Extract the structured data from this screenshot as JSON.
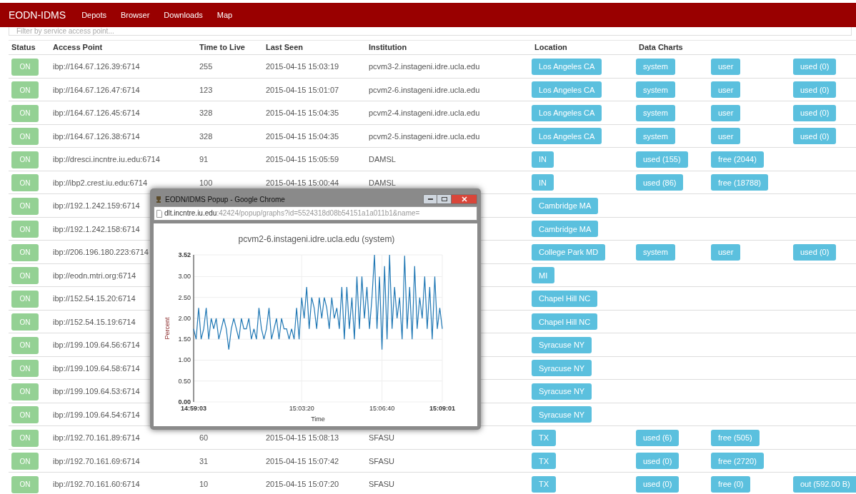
{
  "navbar": {
    "brand": "EODN-IDMS",
    "links": [
      "Depots",
      "Browser",
      "Downloads",
      "Map"
    ]
  },
  "filter": {
    "placeholder": "Filter by service access point..."
  },
  "table": {
    "columns": [
      "Status",
      "Access Point",
      "Time to Live",
      "Last Seen",
      "Institution",
      "Location",
      "Data Charts"
    ],
    "rows": [
      {
        "status": "ON",
        "access_point": "ibp://164.67.126.39:6714",
        "ttl": "255",
        "last_seen": "2015-04-15 15:03:19",
        "institution": "pcvm3-2.instageni.idre.ucla.edu",
        "location": "Los Angeles CA",
        "charts": [
          "system",
          "user",
          "used (0)"
        ]
      },
      {
        "status": "ON",
        "access_point": "ibp://164.67.126.47:6714",
        "ttl": "123",
        "last_seen": "2015-04-15 15:01:07",
        "institution": "pcvm2-6.instageni.idre.ucla.edu",
        "location": "Los Angeles CA",
        "charts": [
          "system",
          "user",
          "used (0)"
        ]
      },
      {
        "status": "ON",
        "access_point": "ibp://164.67.126.45:6714",
        "ttl": "328",
        "last_seen": "2015-04-15 15:04:35",
        "institution": "pcvm2-4.instageni.idre.ucla.edu",
        "location": "Los Angeles CA",
        "charts": [
          "system",
          "user",
          "used (0)"
        ]
      },
      {
        "status": "ON",
        "access_point": "ibp://164.67.126.38:6714",
        "ttl": "328",
        "last_seen": "2015-04-15 15:04:35",
        "institution": "pcvm2-5.instageni.idre.ucla.edu",
        "location": "Los Angeles CA",
        "charts": [
          "system",
          "user",
          "used (0)"
        ]
      },
      {
        "status": "ON",
        "access_point": "ibp://dresci.incntre.iu.edu:6714",
        "ttl": "91",
        "last_seen": "2015-04-15 15:05:59",
        "institution": "DAMSL",
        "location": "IN",
        "charts": [
          "used (155)",
          "free (2044)"
        ]
      },
      {
        "status": "ON",
        "access_point": "ibp://ibp2.crest.iu.edu:6714",
        "ttl": "100",
        "last_seen": "2015-04-15 15:00:44",
        "institution": "DAMSL",
        "location": "IN",
        "charts": [
          "used (86)",
          "free (18788)"
        ]
      },
      {
        "status": "ON",
        "access_point": "ibp://192.1.242.159:6714",
        "location": "Cambridge MA"
      },
      {
        "status": "ON",
        "access_point": "ibp://192.1.242.158:6714",
        "location": "Cambridge MA"
      },
      {
        "status": "ON",
        "access_point": "ibp://206.196.180.223:6714",
        "location": "College Park MD",
        "charts": [
          "system",
          "user",
          "used (0)"
        ]
      },
      {
        "status": "ON",
        "access_point": "ibp://eodn.mtri.org:6714",
        "location": "MI"
      },
      {
        "status": "ON",
        "access_point": "ibp://152.54.15.20:6714",
        "location": "Chapel Hill NC"
      },
      {
        "status": "ON",
        "access_point": "ibp://152.54.15.19:6714",
        "location": "Chapel Hill NC"
      },
      {
        "status": "ON",
        "access_point": "ibp://199.109.64.56:6714",
        "location": "Syracuse NY"
      },
      {
        "status": "ON",
        "access_point": "ibp://199.109.64.58:6714",
        "location": "Syracuse NY"
      },
      {
        "status": "ON",
        "access_point": "ibp://199.109.64.53:6714",
        "location": "Syracuse NY"
      },
      {
        "status": "ON",
        "access_point": "ibp://199.109.64.54:6714",
        "location": "Syracuse NY"
      },
      {
        "status": "ON",
        "access_point": "ibp://192.70.161.89:6714",
        "ttl": "60",
        "last_seen": "2015-04-15 15:08:13",
        "institution": "SFASU",
        "location": "TX",
        "charts": [
          "used (6)",
          "free (505)"
        ]
      },
      {
        "status": "ON",
        "access_point": "ibp://192.70.161.69:6714",
        "ttl": "31",
        "last_seen": "2015-04-15 15:07:42",
        "institution": "SFASU",
        "location": "TX",
        "charts": [
          "used (0)",
          "free (2720)"
        ]
      },
      {
        "status": "ON",
        "access_point": "ibp://192.70.161.60:6714",
        "ttl": "10",
        "last_seen": "2015-04-15 15:07:20",
        "institution": "SFASU",
        "location": "TX",
        "charts": [
          "used (0)",
          "free (0)",
          "out (592.00 B)"
        ]
      }
    ]
  },
  "popup": {
    "title": "EODN/IDMS Popup - Google Chrome",
    "url": "**dlt.incntre.iu.edu**:42424/popup/graphs?id=5524318d08b54151a1a011b1&name=",
    "chart_data": {
      "type": "line",
      "title": "pcvm2-6.instageni.idre.ucla.edu (system)",
      "xlabel": "Time",
      "ylabel": "Percent",
      "grid": true,
      "ylim": [
        0,
        3.52
      ],
      "categories": [
        "14:59:03",
        null,
        null,
        null,
        null,
        null,
        null,
        null,
        null,
        null,
        null,
        null,
        null,
        null,
        null,
        null,
        null,
        null,
        null,
        null,
        null,
        null,
        null,
        null,
        null,
        null,
        null,
        null,
        null,
        null,
        null,
        null,
        null,
        null,
        null,
        null,
        null,
        null,
        null,
        null,
        null,
        null,
        null,
        "15:03:20",
        null,
        null,
        null,
        null,
        null,
        null,
        null,
        null,
        null,
        null,
        null,
        null,
        null,
        null,
        null,
        null,
        null,
        null,
        null,
        null,
        null,
        null,
        null,
        null,
        null,
        null,
        null,
        null,
        null,
        null,
        null,
        "15:06:40",
        null,
        null,
        null,
        null,
        null,
        null,
        null,
        null,
        null,
        null,
        null,
        null,
        null,
        null,
        null,
        null,
        null,
        null,
        null,
        null,
        null,
        null,
        null,
        "15:09:01"
      ],
      "yticks": [
        {
          "value": 0,
          "label": "0.00"
        },
        {
          "value": 0.5,
          "label": "0.50"
        },
        {
          "value": 1,
          "label": "1.00"
        },
        {
          "value": 1.5,
          "label": "1.50"
        },
        {
          "value": 2,
          "label": "2.00"
        },
        {
          "value": 2.5,
          "label": "2.50"
        },
        {
          "value": 3,
          "label": "3.00"
        },
        {
          "value": 3.52,
          "label": "3.52"
        }
      ],
      "series": [
        {
          "color": "#1f77b4",
          "values": [
            1.75,
            1.5,
            2.25,
            1.5,
            1.75,
            2.25,
            1.5,
            2.0,
            1.75,
            2.0,
            1.5,
            1.75,
            2.0,
            1.75,
            1.25,
            1.75,
            2.0,
            1.75,
            1.5,
            2.0,
            1.75,
            1.75,
            2.0,
            1.5,
            1.75,
            1.5,
            2.25,
            1.75,
            1.5,
            1.75,
            2.25,
            1.5,
            1.75,
            2.0,
            1.5,
            2.0,
            1.75,
            1.75,
            1.5,
            1.75,
            1.5,
            2.25,
            1.5,
            2.5,
            2.0,
            2.75,
            1.75,
            2.5,
            2.25,
            1.75,
            2.5,
            2.0,
            2.5,
            2.25,
            1.75,
            2.5,
            2.0,
            2.25,
            1.75,
            2.75,
            1.5,
            2.75,
            1.75,
            2.5,
            1.5,
            3.0,
            1.75,
            3.0,
            2.0,
            2.75,
            1.75,
            2.5,
            3.52,
            1.75,
            3.0,
            1.25,
            3.25,
            1.5,
            3.52,
            1.75,
            2.75,
            2.0,
            2.5,
            1.5,
            3.5,
            1.75,
            2.75,
            1.5,
            3.25,
            1.75,
            2.5,
            2.0,
            3.0,
            1.75,
            2.75,
            1.5,
            3.0,
            1.75,
            2.25,
            1.75
          ]
        }
      ]
    }
  }
}
